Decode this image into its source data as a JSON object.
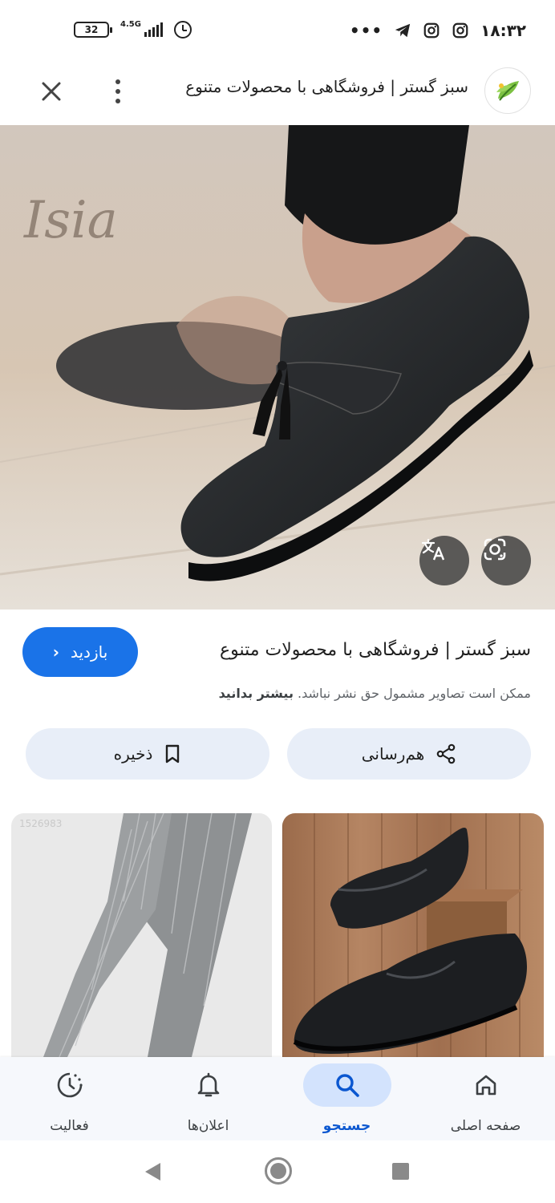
{
  "status_bar": {
    "time": "۱۸:۳۲",
    "battery": "32",
    "network": "4.5G",
    "overflow": "•••",
    "icons": [
      "telegram-icon",
      "instagram-icon",
      "instagram-icon",
      "signal-icon",
      "alarm-icon"
    ]
  },
  "app_bar": {
    "title": "سبز گستر | فروشگاهی با محصولات متنوع",
    "icons": [
      "close-icon",
      "more-vert-icon",
      "site-favicon"
    ]
  },
  "hero": {
    "watermark": "Isia",
    "buttons": [
      "translate-icon",
      "lens-icon"
    ]
  },
  "result": {
    "title": "سبز گستر | فروشگاهی با محصولات متنوع",
    "visit_label": "بازدید",
    "copyright_note": "ممکن است تصاویر مشمول حق نشر نباشد.",
    "learn_more": "بیشتر بدانید"
  },
  "actions": {
    "share_label": "هم‌رسانی",
    "save_label": "ذخیره"
  },
  "related": {
    "thumb_id": "1526983"
  },
  "bottom_nav": {
    "items": [
      {
        "label": "صفحه اصلی",
        "icon": "home-icon"
      },
      {
        "label": "جستجو",
        "icon": "search-icon",
        "active": true
      },
      {
        "label": "اعلان‌ها",
        "icon": "bell-icon"
      },
      {
        "label": "فعالیت",
        "icon": "activity-icon"
      }
    ]
  },
  "colors": {
    "accent": "#1a73e8",
    "pill_bg": "#e8eef8",
    "nav_active_bg": "#d3e3fd",
    "nav_active_text": "#0b57d0"
  }
}
